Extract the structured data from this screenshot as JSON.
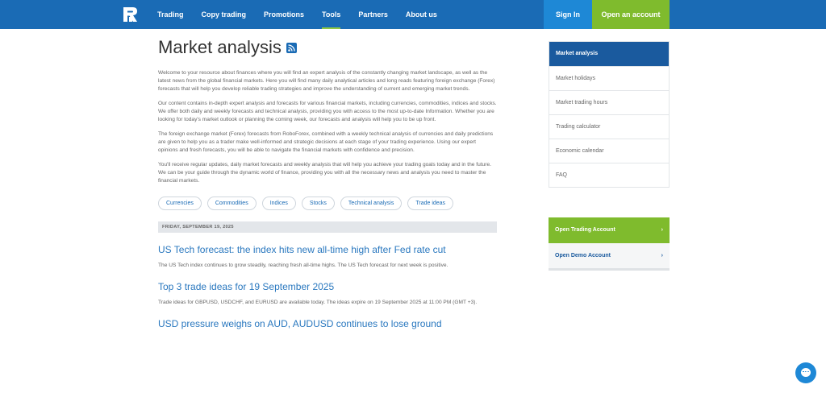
{
  "header": {
    "logo_icon": "roboforex-logo-icon",
    "nav": [
      "Trading",
      "Copy trading",
      "Promotions",
      "Tools",
      "Partners",
      "About us"
    ],
    "active_nav": "Tools",
    "sign_in": "Sign In",
    "open_account": "Open an account",
    "colors": {
      "bar": "#1a6bb5",
      "sign_in": "#1e88d6",
      "open_account": "#7fbb2d"
    }
  },
  "main": {
    "title": "Market analysis",
    "rss_icon": "rss-icon",
    "intro": [
      "Welcome to your resource about finances where you will find an expert analysis of the constantly changing market landscape, as well as the latest news from the global financial markets. Here you will find many daily analytical articles and long reads featuring foreign exchange (Forex) forecasts that will help you develop reliable trading strategies and improve the understanding of current and emerging market trends.",
      "Our content contains in-depth expert analysis and forecasts for various financial markets, including currencies, commodities, indices and stocks. We offer both daily and weekly forecasts and technical analysis, providing you with access to the most up-to-date Information. Whether you are looking for today's market outlook or planning the coming week, our forecasts and analysis will help you to be up front.",
      "The foreign exchange market (Forex) forecasts from RoboForex, combined with a weekly technical analysis of currencies and daily predictions are given to help you as a trader make well-informed and strategic decisions at each stage of your trading experience. Using our expert opinions and fresh forecasts, you will be able to navigate the financial markets with confidence and precision.",
      "You'll receive regular updates, daily market forecasts and weekly analysis that will help you achieve your trading goals today and in the future. We can be your guide through the dynamic world of finance, providing you with all the necessary news and analysis you need to master the financial markets."
    ],
    "tags": [
      "Currencies",
      "Commodities",
      "Indices",
      "Stocks",
      "Technical analysis",
      "Trade ideas"
    ],
    "date": "FRIDAY, SEPTEMBER 19, 2025",
    "articles": [
      {
        "title": "US Tech forecast: the index hits new all-time high after Fed rate cut",
        "desc": "The US Tech index continues to grow steadily, reaching fresh all-time highs. The US Tech forecast for next week is positive."
      },
      {
        "title": "Top 3 trade ideas for 19 September 2025",
        "desc": "Trade ideas for GBPUSD, USDCHF, and EURUSD are available today. The ideas expire on 19 September 2025 at 11:00 PM (GMT +3)."
      },
      {
        "title": "USD pressure weighs on AUD, AUDUSD continues to lose ground",
        "desc": ""
      }
    ]
  },
  "sidebar": {
    "items": [
      "Market analysis",
      "Market holidays",
      "Market trading hours",
      "Trading calculator",
      "Economic calendar",
      "FAQ"
    ],
    "active": "Market analysis",
    "cta_trading": "Open Trading Account",
    "cta_demo": "Open Demo Account",
    "chevron": "›"
  },
  "chat_icon": "chat-bubble-icon"
}
